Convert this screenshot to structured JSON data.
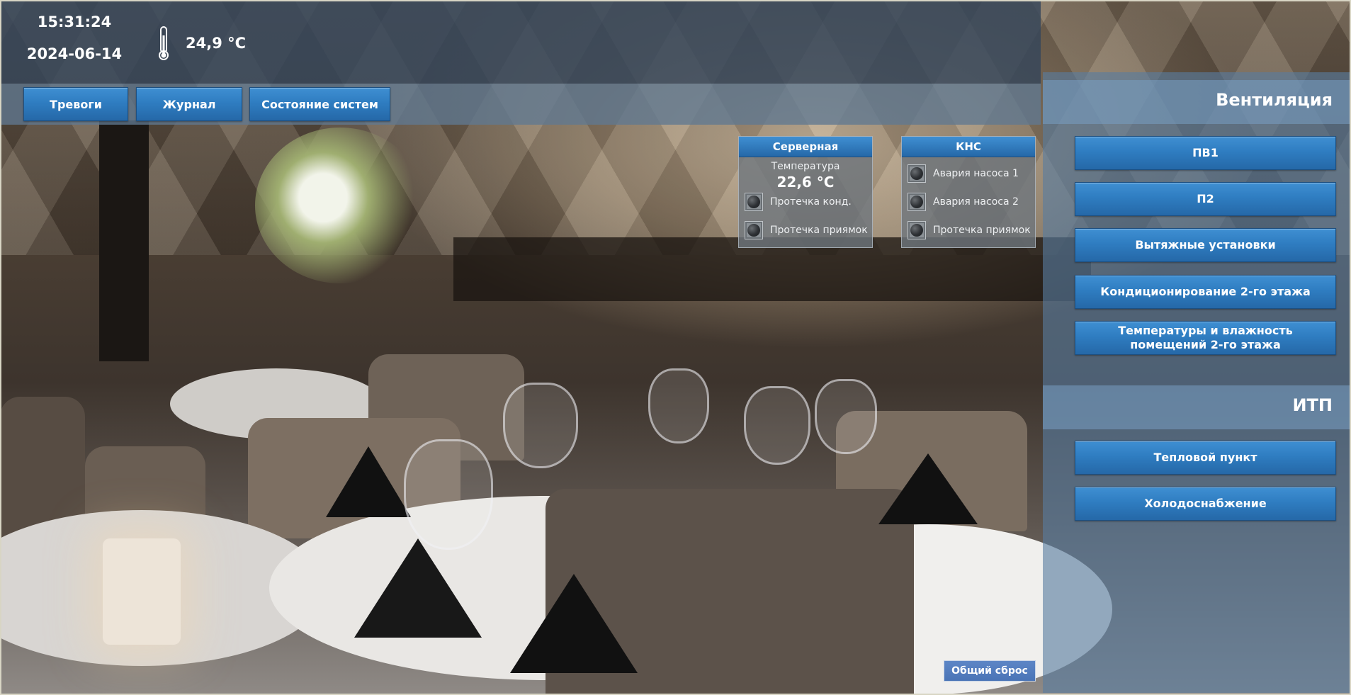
{
  "header": {
    "time": "15:31:24",
    "date": "2024-06-14",
    "outdoor_temp": "24,9 °C",
    "thermometer_icon": "thermometer-icon"
  },
  "nav": {
    "alarms": "Тревоги",
    "journal": "Журнал",
    "systems_status": "Состояние систем"
  },
  "server_room": {
    "title": "Серверная",
    "temp_label": "Температура",
    "temp_value": "22,6 °C",
    "sensors": [
      {
        "label": "Протечка конд."
      },
      {
        "label": "Протечка приямок"
      }
    ]
  },
  "kns": {
    "title": "КНС",
    "sensors": [
      {
        "label": "Авария насоса 1"
      },
      {
        "label": "Авария насоса 2"
      },
      {
        "label": "Протечка приямок"
      }
    ]
  },
  "ventilation": {
    "title": "Вентиляция",
    "buttons": [
      "ПВ1",
      "П2",
      "Вытяжные установки",
      "Кондиционирование 2-го этажа",
      "Температуры и влажность помещений 2-го этажа"
    ]
  },
  "itp": {
    "title": "ИТП",
    "buttons": [
      "Тепловой пункт",
      "Холодоснабжение"
    ]
  },
  "reset_label": "Общий сброс",
  "colors": {
    "button_blue": "#2f7dc1",
    "header_bar": "#34465a",
    "panel": "#587da0"
  }
}
